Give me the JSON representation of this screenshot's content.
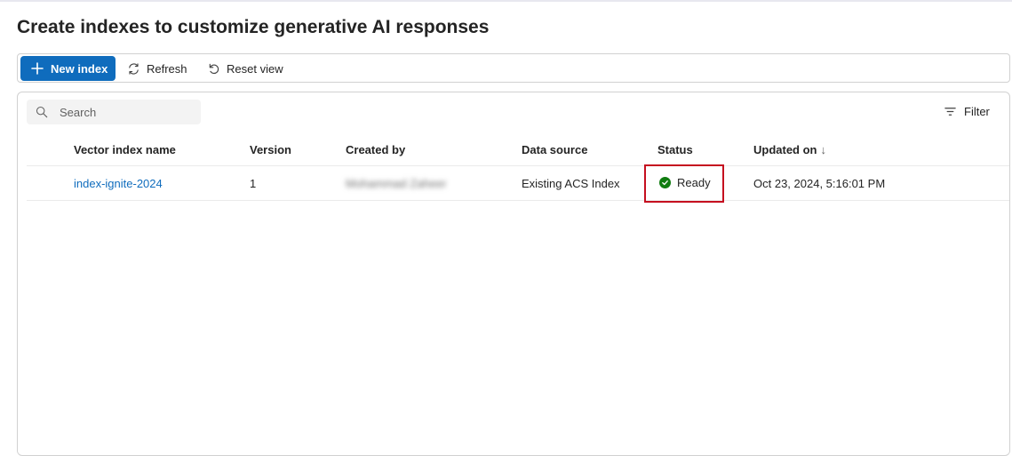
{
  "page": {
    "title": "Create indexes to customize generative AI responses"
  },
  "toolbar": {
    "new_index_label": "New index",
    "refresh_label": "Refresh",
    "reset_view_label": "Reset view"
  },
  "grid": {
    "search_placeholder": "Search",
    "filter_label": "Filter",
    "columns": [
      "Vector index name",
      "Version",
      "Created by",
      "Data source",
      "Status",
      "Updated on"
    ],
    "sort_indicator": "↓",
    "rows": [
      {
        "name": "index-ignite-2024",
        "version": "1",
        "created_by": "Mohammad Zaheer",
        "data_source": "Existing ACS Index",
        "status": "Ready",
        "updated_on": "Oct 23, 2024, 5:16:01 PM"
      }
    ]
  },
  "colors": {
    "accent": "#0f6cbd",
    "status_ready": "#107c10",
    "highlight": "#c50f1f"
  },
  "icons": {
    "new_index": "plus-icon",
    "refresh": "refresh-icon",
    "reset_view": "undo-icon",
    "search": "search-icon",
    "filter": "filter-icon",
    "status_ready": "check-circle-icon"
  }
}
